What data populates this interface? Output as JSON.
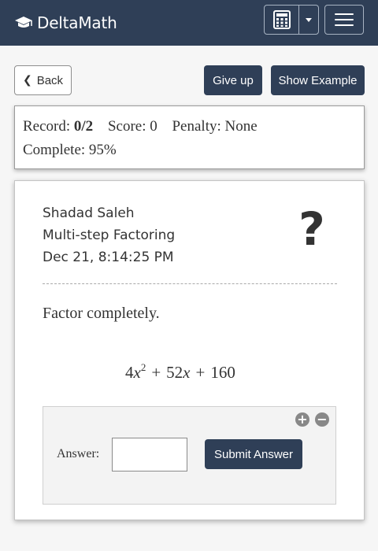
{
  "navbar": {
    "brand": "DeltaMath",
    "brand_icon": "graduation-cap-icon",
    "calculator_icon": "calculator-icon",
    "dropdown_icon": "caret-down-icon",
    "menu_icon": "hamburger-menu-icon",
    "background_color": "#2f3f57"
  },
  "toolbar": {
    "back_label": "Back",
    "give_up_label": "Give up",
    "show_example_label": "Show Example"
  },
  "record": {
    "record_label": "Record:",
    "record_value": "0/2",
    "score_label": "Score:",
    "score_value": "0",
    "penalty_label": "Penalty:",
    "penalty_value": "None",
    "complete_label": "Complete:",
    "complete_value": "95%"
  },
  "problem": {
    "student_name": "Shadad Saleh",
    "skill_name": "Multi-step Factoring",
    "timestamp": "Dec 21, 8:14:25 PM",
    "help_glyph": "?",
    "instruction": "Factor completely.",
    "expression": {
      "term1_coef": "4",
      "term1_var": "x",
      "term1_exp": "2",
      "op1": "+",
      "term2_coef": "52",
      "term2_var": "x",
      "op2": "+",
      "constant": "160"
    }
  },
  "answer": {
    "label": "Answer:",
    "value": "",
    "submit_label": "Submit Answer",
    "plus_glyph": "+",
    "minus_glyph": "−"
  },
  "colors": {
    "accent": "#2f3f57",
    "text": "#333333",
    "page_background": "#f6f6f6"
  }
}
